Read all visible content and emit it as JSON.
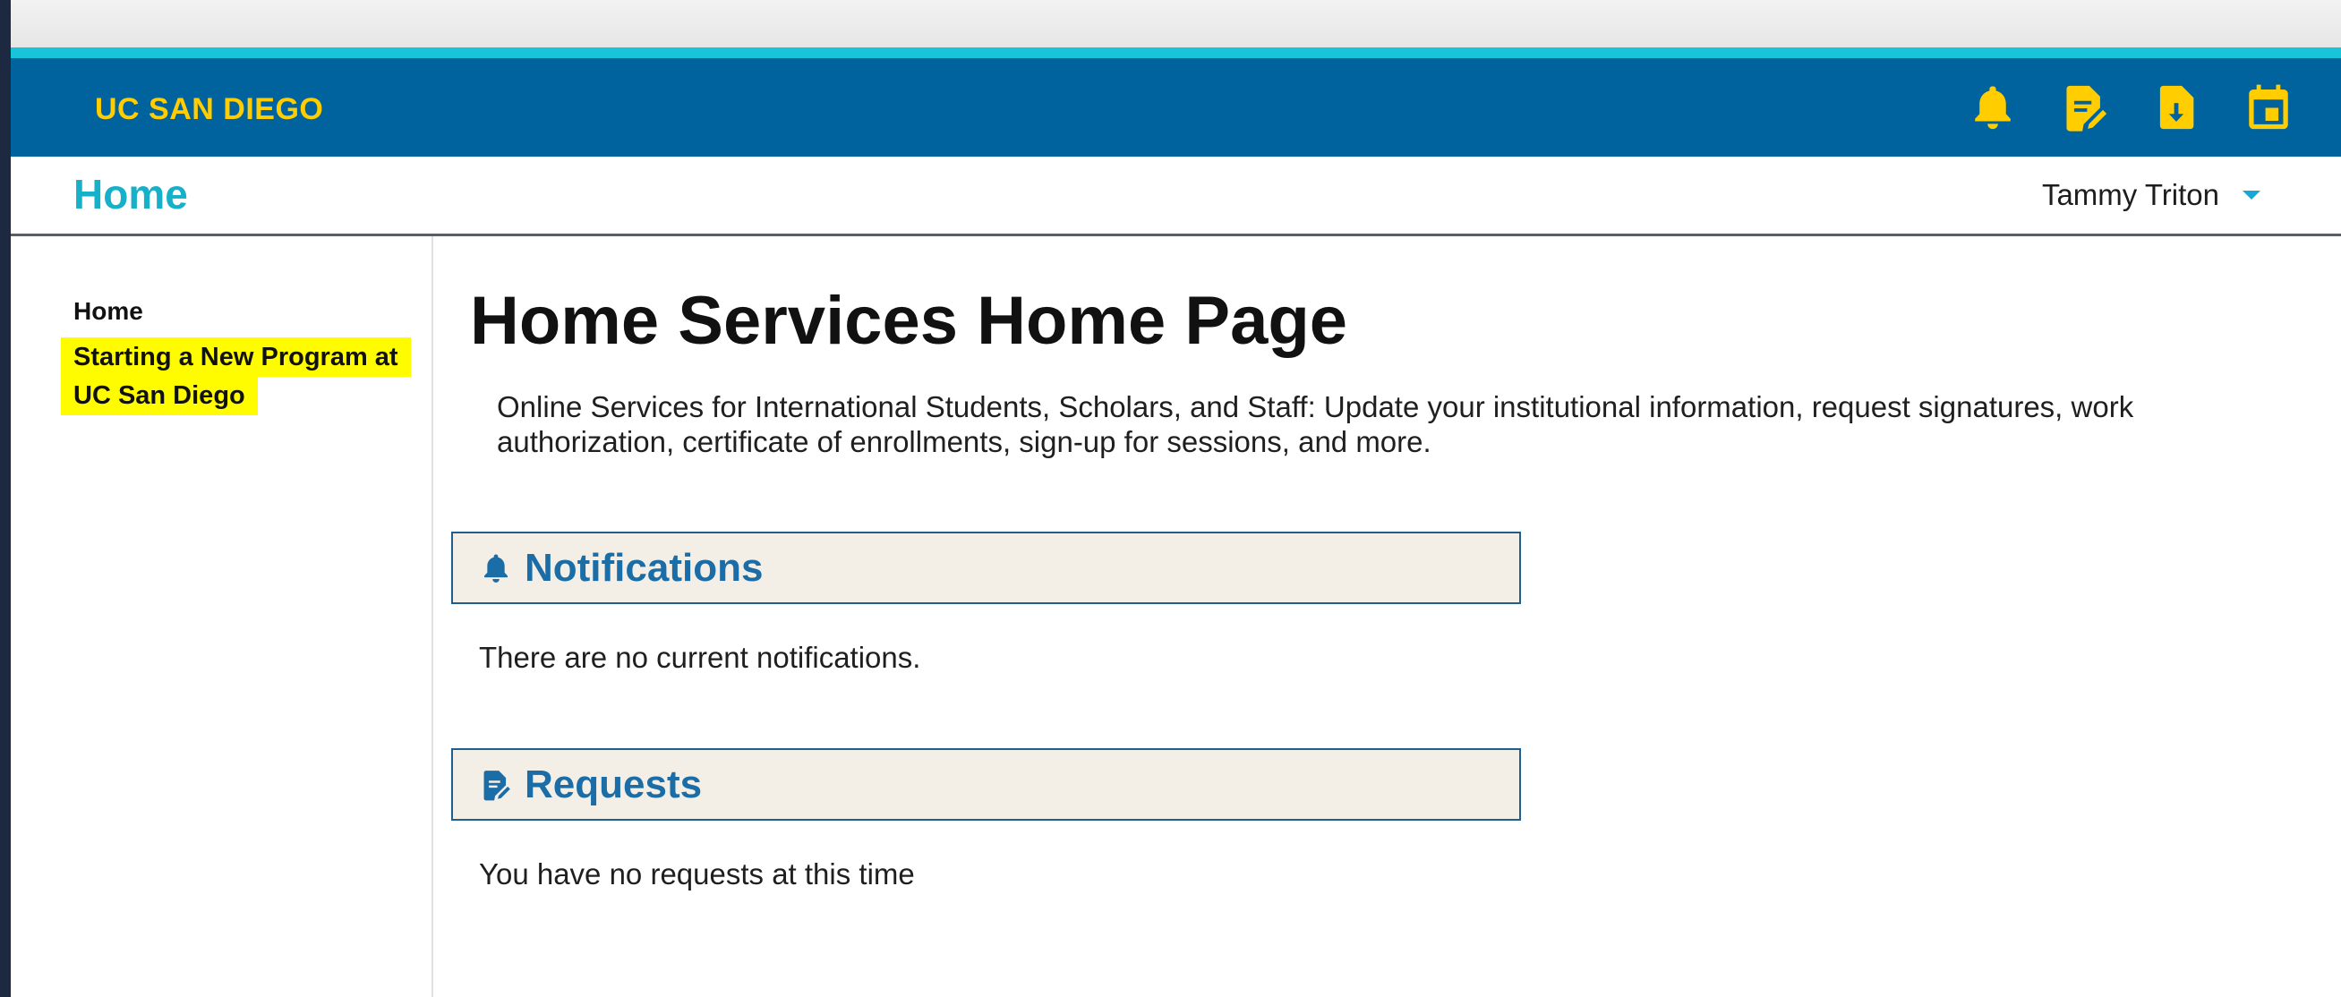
{
  "header": {
    "brand": "UC SAN DIEGO",
    "icon_color": "#ffcd00",
    "bar_color": "#00639e",
    "accent_color": "#17c4d9",
    "icons": [
      "bell-icon",
      "request-edit-icon",
      "document-download-icon",
      "calendar-icon"
    ]
  },
  "subheader": {
    "title": "Home",
    "user_name": "Tammy Triton"
  },
  "sidebar": {
    "items": [
      {
        "label": "Home"
      },
      {
        "label": "Starting a New Program at UC San Diego",
        "highlight_color": "#fffc00"
      }
    ]
  },
  "main": {
    "heading": "Home Services Home Page",
    "intro": "Online Services for International Students, Scholars, and Staff: Update your institutional information, request signatures, work authorization, certificate of enrollments, sign-up for sessions, and more.",
    "sections": [
      {
        "title": "Notifications",
        "icon": "bell-icon",
        "text": "There are no current notifications."
      },
      {
        "title": "Requests",
        "icon": "request-edit-icon",
        "text": "You have no requests at this time"
      }
    ]
  }
}
